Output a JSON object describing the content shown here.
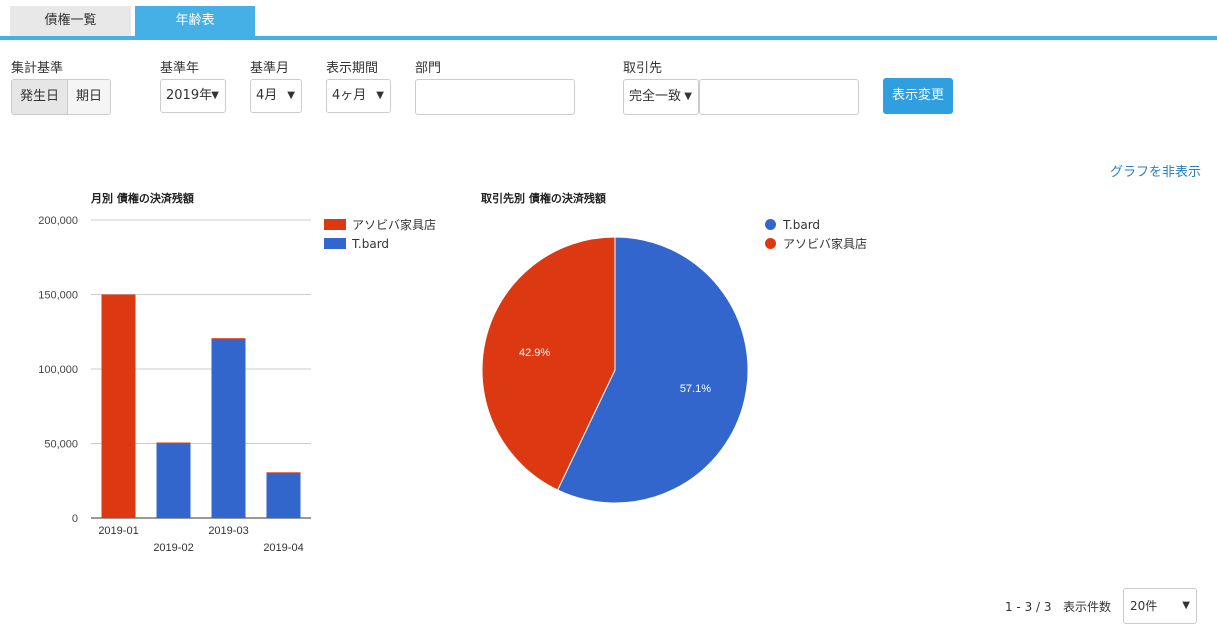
{
  "tabs": [
    {
      "label": "債権一覧",
      "active": false
    },
    {
      "label": "年齢表",
      "active": true
    }
  ],
  "filters": {
    "aggregation_label": "集計基準",
    "aggregation_options": [
      "発生日",
      "期日"
    ],
    "aggregation_selected": "発生日",
    "year_label": "基準年",
    "year_value": "2019年",
    "month_label": "基準月",
    "month_value": "4月",
    "period_label": "表示期間",
    "period_value": "4ヶ月",
    "dept_label": "部門",
    "dept_value": "",
    "partner_label": "取引先",
    "partner_match_value": "完全一致",
    "partner_value": "",
    "apply_button": "表示変更"
  },
  "hide_graph_link": "グラフを非表示",
  "arrow_glyph": "▼",
  "colors": {
    "accent": "#45b0e6",
    "red": "#dc3912",
    "blue": "#3366cc"
  },
  "chart_data": [
    {
      "type": "bar",
      "title": "月別 債権の決済残額",
      "categories": [
        "2019-01",
        "2019-02",
        "2019-03",
        "2019-04"
      ],
      "series": [
        {
          "name": "アソビバ家具店",
          "color": "#dc3912",
          "values": [
            150000,
            0,
            0,
            0
          ]
        },
        {
          "name": "T.bard",
          "color": "#3366cc",
          "values": [
            0,
            50000,
            120000,
            30000
          ]
        }
      ],
      "ylim": [
        0,
        200000
      ],
      "yticks": [
        "200,000",
        "150,000",
        "100,000",
        "50,000",
        "0"
      ],
      "legend": "right"
    },
    {
      "type": "pie",
      "title": "取引先別 債権の決済残額",
      "slices": [
        {
          "name": "T.bard",
          "color": "#3366cc",
          "percent": 57.1,
          "label": "57.1%"
        },
        {
          "name": "アソビバ家具店",
          "color": "#dc3912",
          "percent": 42.9,
          "label": "42.9%"
        }
      ],
      "legend": "right"
    }
  ],
  "pager": {
    "range_text": "1 - 3 / 3",
    "per_page_label": "表示件数",
    "per_page_value": "20件"
  }
}
